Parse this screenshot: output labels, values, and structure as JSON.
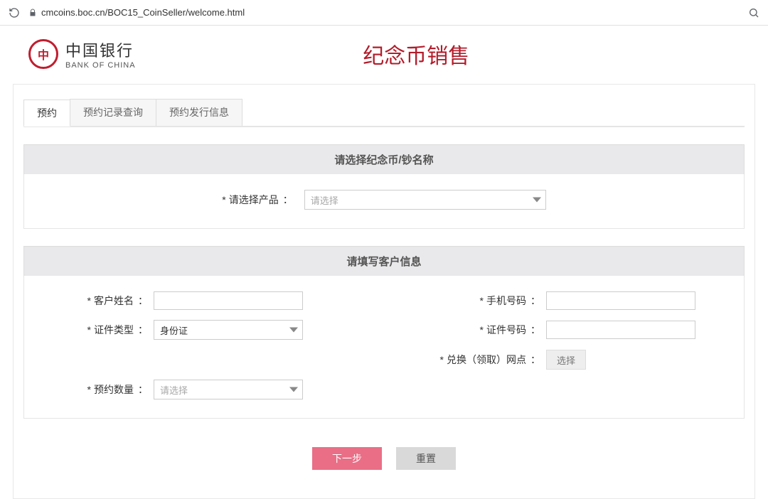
{
  "browser": {
    "url": "cmcoins.boc.cn/BOC15_CoinSeller/welcome.html"
  },
  "header": {
    "logo_cn": "中国银行",
    "logo_en": "BANK OF CHINA",
    "title": "纪念币销售"
  },
  "tabs": [
    {
      "label": "预约",
      "active": true
    },
    {
      "label": "预约记录查询",
      "active": false
    },
    {
      "label": "预约发行信息",
      "active": false
    }
  ],
  "sections": {
    "product": {
      "title": "请选择纪念币/钞名称",
      "product_label": "请选择产品",
      "product_placeholder": "请选择"
    },
    "customer": {
      "title": "请填写客户信息",
      "name_label": "客户姓名",
      "idtype_label": "证件类型",
      "idtype_value": "身份证",
      "qty_label": "预约数量",
      "qty_placeholder": "请选择",
      "phone_label": "手机号码",
      "idnum_label": "证件号码",
      "branch_label": "兑换（领取）网点",
      "branch_btn": "选择"
    }
  },
  "actions": {
    "next": "下一步",
    "reset": "重置"
  },
  "glyphs": {
    "star": "*",
    "colon": "："
  }
}
